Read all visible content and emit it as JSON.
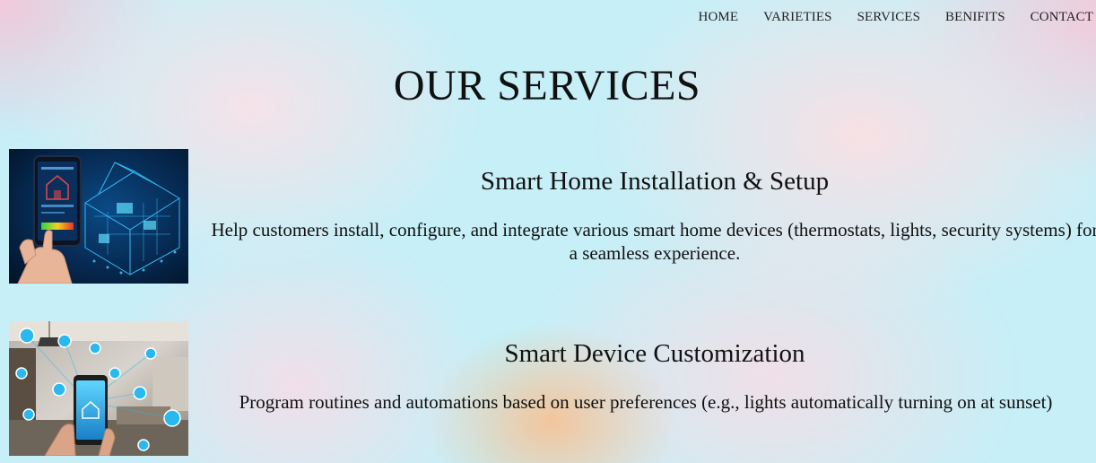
{
  "nav": {
    "items": [
      {
        "label": "HOME"
      },
      {
        "label": "VARIETIES"
      },
      {
        "label": "SERVICES"
      },
      {
        "label": "BENIFITS"
      },
      {
        "label": "CONTACT"
      }
    ]
  },
  "page": {
    "title": "OUR SERVICES"
  },
  "services": [
    {
      "name": "Smart Home Installation & Setup",
      "description": "Help customers install, configure, and integrate various smart home devices (thermostats, lights, security systems) for a seamless experience.",
      "image_icon": "smart-home-tablet-photo"
    },
    {
      "name": "Smart Device Customization",
      "description": "Program routines and automations based on user preferences (e.g., lights automatically turning on at sunset)",
      "image_icon": "smart-phone-room-photo"
    }
  ],
  "colors": {
    "background_base": "#c6eff7",
    "background_pink": "#f8e2e8",
    "background_orange": "#fabe8c",
    "text": "#111111"
  }
}
